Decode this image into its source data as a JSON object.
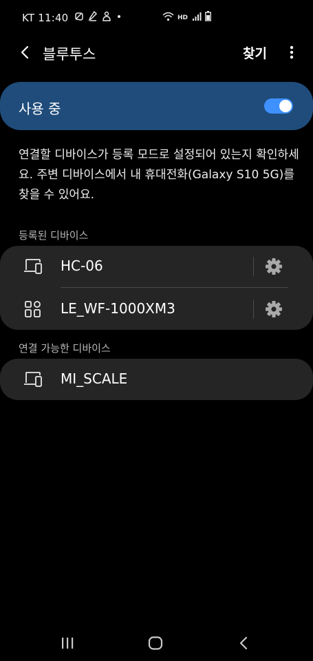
{
  "status_bar": {
    "time": "KT 11:40",
    "notification_icons": [
      "chat-bubble-icon",
      "wrench-icon",
      "bixby-icon",
      "dot-icon"
    ],
    "system_icons": [
      "wifi-icon",
      "hd-voice-icon",
      "signal-icon",
      "battery-icon"
    ]
  },
  "app_bar": {
    "title": "블루투스",
    "scan_label": "찾기"
  },
  "master_switch": {
    "label": "사용 중",
    "on": true,
    "accent_color": "#3e91ff",
    "background_color": "#1f4c7a"
  },
  "description": "연결할 디바이스가 등록 모드로 설정되어 있는지 확인하세요. 주변 디바이스에서 내 휴대전화(Galaxy S10 5G)를 찾을 수 있어요.",
  "paired_section": {
    "header": "등록된 디바이스",
    "devices": [
      {
        "name": "HC-06",
        "icon": "phone-device-icon"
      },
      {
        "name": "LE_WF-1000XM3",
        "icon": "generic-device-icon"
      }
    ]
  },
  "available_section": {
    "header": "연결 가능한 디바이스",
    "devices": [
      {
        "name": "MI_SCALE",
        "icon": "phone-device-icon"
      }
    ]
  },
  "nav_bar": {
    "icons": [
      "recents-icon",
      "home-icon",
      "back-nav-icon"
    ]
  }
}
